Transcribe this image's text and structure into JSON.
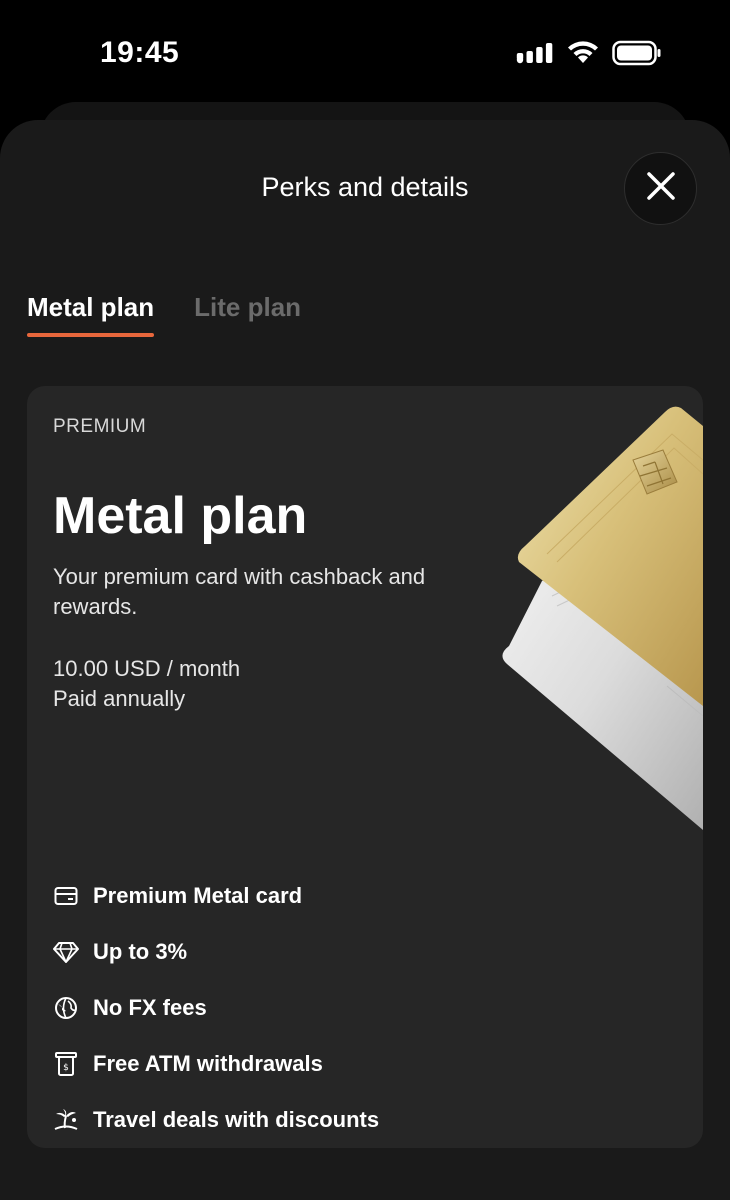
{
  "status_bar": {
    "time": "19:45"
  },
  "sheet": {
    "title": "Perks and details",
    "tabs": [
      {
        "label": "Metal plan",
        "active": true
      },
      {
        "label": "Lite plan",
        "active": false
      }
    ]
  },
  "plan": {
    "tier": "PREMIUM",
    "name": "Metal plan",
    "description": "Your premium card with cashback and rewards.",
    "price": "10.00 USD / month",
    "billing": "Paid annually",
    "features": [
      {
        "icon": "card-icon",
        "label": "Premium Metal card"
      },
      {
        "icon": "diamond-icon",
        "label": "Up to 3%"
      },
      {
        "icon": "globe-icon",
        "label": "No FX fees"
      },
      {
        "icon": "atm-icon",
        "label": "Free ATM withdrawals"
      },
      {
        "icon": "palm-tree-icon",
        "label": "Travel deals with discounts"
      }
    ]
  },
  "colors": {
    "accent": "#e8673c",
    "background": "#000000",
    "sheet": "#1a1a1a",
    "card": "#262626"
  }
}
